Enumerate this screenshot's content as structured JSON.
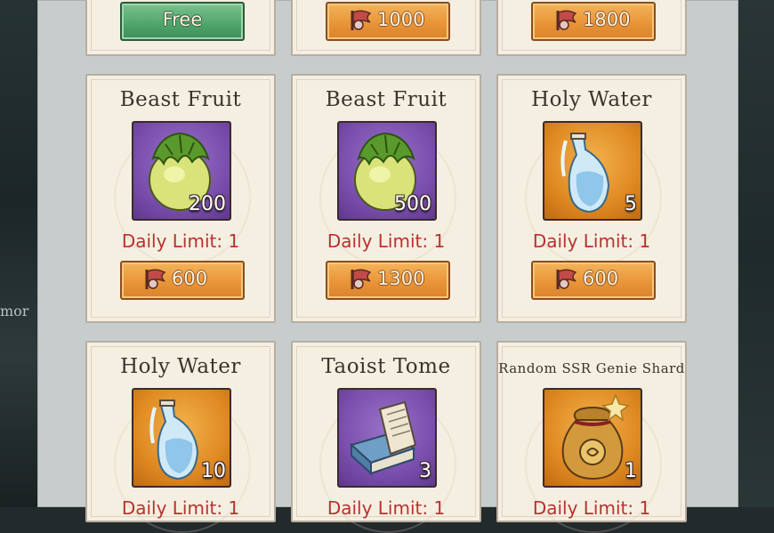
{
  "side": {
    "left_text": "mor"
  },
  "currency_icon": "flag-token-icon",
  "colors": {
    "limit_red": "#b8322d",
    "price_orange": "#e99539",
    "free_green": "#4ea46a",
    "card_bg": "#f5efe2"
  },
  "top_row": [
    {
      "price": "Free"
    },
    {
      "price": "1000"
    },
    {
      "price": "1800"
    }
  ],
  "shop_items": [
    {
      "title": "Beast Fruit",
      "icon": "beast-fruit-icon",
      "qty": "200",
      "limit": "Daily Limit: 1",
      "price": "600"
    },
    {
      "title": "Beast Fruit",
      "icon": "beast-fruit-icon",
      "qty": "500",
      "limit": "Daily Limit: 1",
      "price": "1300"
    },
    {
      "title": "Holy Water",
      "icon": "holy-water-icon",
      "qty": "5",
      "limit": "Daily Limit: 1",
      "price": "600"
    },
    {
      "title": "Holy Water",
      "icon": "holy-water-icon",
      "qty": "10",
      "limit": "Daily Limit: 1"
    },
    {
      "title": "Taoist Tome",
      "icon": "taoist-tome-icon",
      "qty": "3",
      "limit": "Daily Limit: 1"
    },
    {
      "title": "Random SSR Genie Shard",
      "icon": "genie-shard-bag-icon",
      "qty": "1",
      "limit": "Daily Limit: 1"
    }
  ]
}
